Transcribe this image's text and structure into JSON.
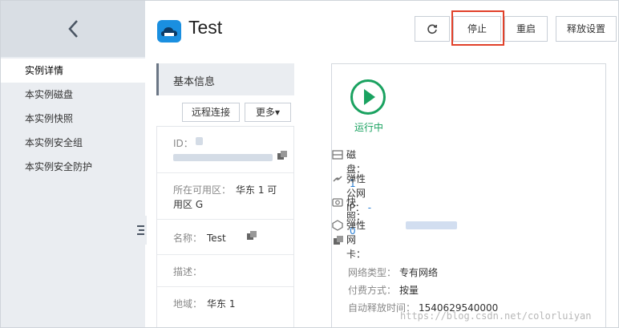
{
  "sidebar": {
    "items": [
      {
        "label": "实例详情",
        "active": true
      },
      {
        "label": "本实例磁盘"
      },
      {
        "label": "本实例快照"
      },
      {
        "label": "本实例安全组"
      },
      {
        "label": "本实例安全防护"
      }
    ]
  },
  "header": {
    "title": "Test",
    "buttons": {
      "stop": "停止",
      "restart": "重启",
      "release": "释放设置"
    }
  },
  "info": {
    "tab_label": "基本信息",
    "remote_connect": "远程连接",
    "more": "更多▾",
    "id_label": "ID：",
    "zone_label": "所在可用区：",
    "zone_value_line1": "华东 1 可",
    "zone_value_line2": "用区 G",
    "name_label": "名称：",
    "name_value": "Test",
    "desc_label": "描述：",
    "region_label": "地域：",
    "region_value": "华东 1"
  },
  "status": {
    "text": "运行中",
    "color": "#1aa260",
    "disk_label": "磁盘：",
    "disk_value": "1",
    "eip_label": "弹性公网IP：",
    "eip_value": "-",
    "snapshot_label": "快照：",
    "snapshot_value": "0",
    "eni_label": "弹性网卡："
  },
  "meta": {
    "network_type_label": "网络类型：",
    "network_type_value": "专有网络",
    "billing_label": "付费方式：",
    "billing_value": "按量",
    "auto_release_label": "自动释放时间：",
    "auto_release_value": "1540629540000"
  },
  "watermark": "https://blog.csdn.net/colorluiyan",
  "colors": {
    "accent": "#2a7fd4",
    "highlight": "#e1412a",
    "logo": "#1a8fe0"
  }
}
